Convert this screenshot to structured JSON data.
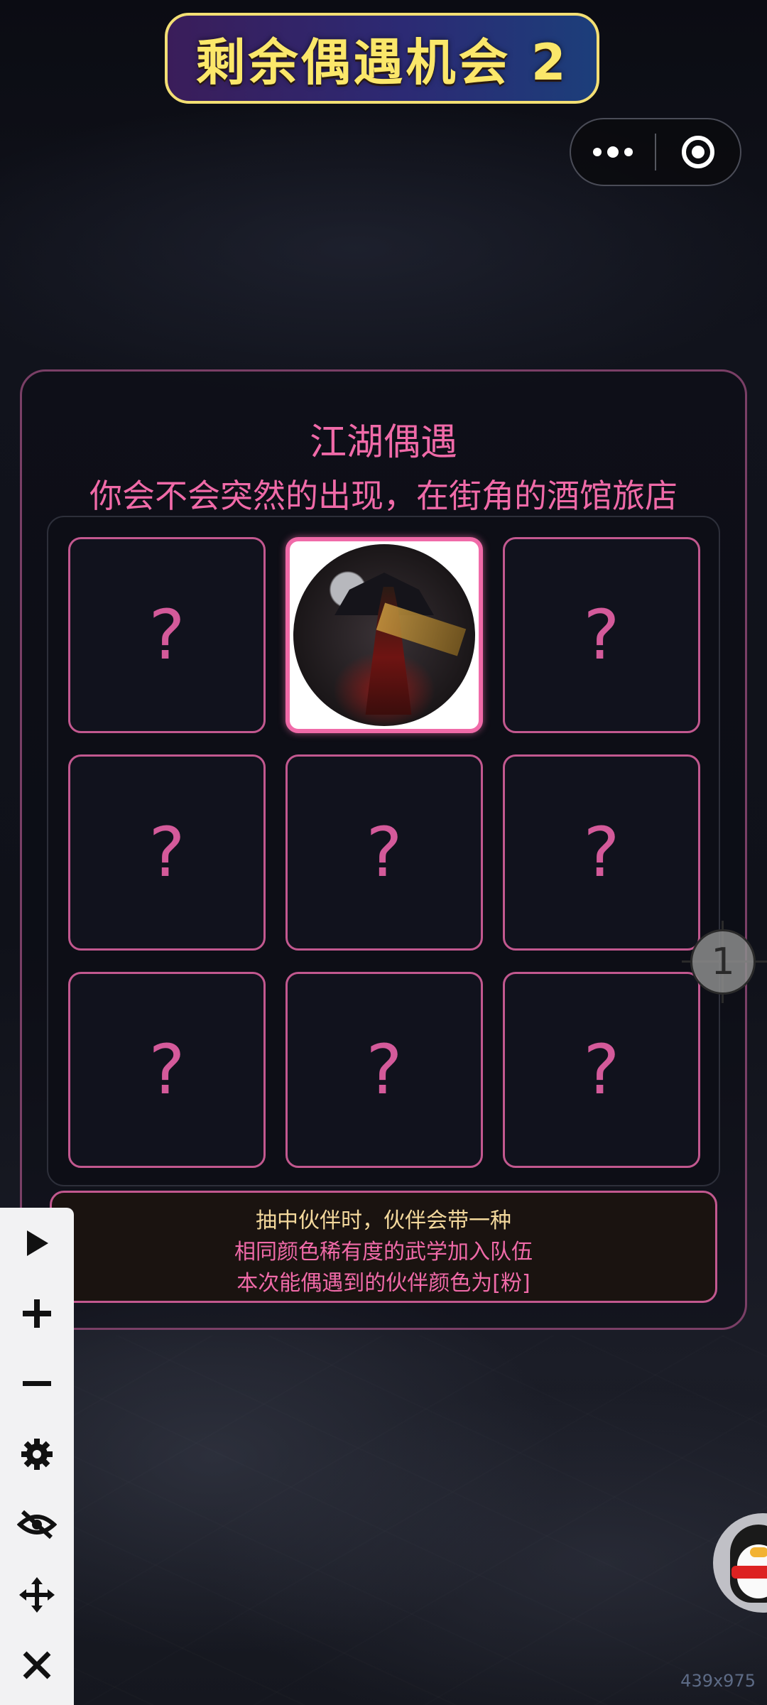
{
  "header": {
    "title": "剩余偶遇机会 2"
  },
  "capsule": {
    "more_icon": "more-dots-icon",
    "close_icon": "target-circle-icon"
  },
  "panel": {
    "title": "江湖偶遇",
    "subtitle": "你会不会突然的出现，在街角的酒馆旅店",
    "cards": [
      {
        "label": "?",
        "revealed": false
      },
      {
        "label": "",
        "revealed": true,
        "image": "warrior-portrait"
      },
      {
        "label": "?",
        "revealed": false
      },
      {
        "label": "?",
        "revealed": false
      },
      {
        "label": "?",
        "revealed": false
      },
      {
        "label": "?",
        "revealed": false
      },
      {
        "label": "?",
        "revealed": false
      },
      {
        "label": "?",
        "revealed": false
      },
      {
        "label": "?",
        "revealed": false
      }
    ],
    "info": {
      "line1": "抽中伙伴时，伙伴会带一种",
      "line2": "相同颜色稀有度的武学加入队伍",
      "line3": "本次能偶遇到的伙伴颜色为[粉]"
    }
  },
  "toolbar": {
    "items": [
      "play-icon",
      "plus-icon",
      "minus-icon",
      "gear-icon",
      "eye-off-icon",
      "move-icon",
      "close-icon"
    ]
  },
  "side_marker": {
    "number": "1"
  },
  "footer": {
    "dimensions": "439x975"
  },
  "colors": {
    "accent_pink": "#f06aa8",
    "card_border": "#c2588f",
    "title_yellow": "#fbe76a",
    "info_gold": "#f3d89c"
  }
}
